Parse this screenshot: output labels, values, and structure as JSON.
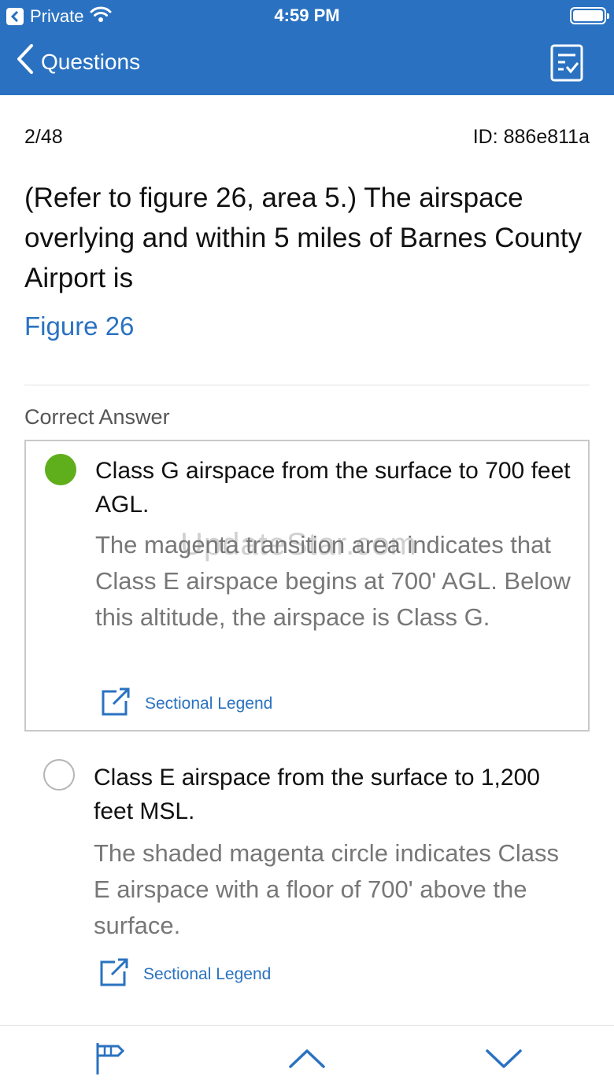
{
  "status_bar": {
    "carrier": "Private",
    "time": "4:59 PM"
  },
  "nav": {
    "back_label": "Questions"
  },
  "question": {
    "progress": "2/48",
    "id_label": "ID: 886e811a",
    "text": "(Refer to figure 26, area 5.) The airspace overlying and within 5 miles of Barnes County Airport is",
    "figure_link": "Figure 26"
  },
  "correct_answer_label": "Correct Answer",
  "answers": [
    {
      "text": "Class G airspace from the surface to 700 feet AGL.",
      "explanation": "The magenta transition area indicates that Class E airspace begins at 700' AGL.  Below this altitude, the airspace is Class G.",
      "link_label": "Sectional Legend",
      "selected": true
    },
    {
      "text": "Class E airspace from the surface to 1,200 feet MSL.",
      "explanation": "The shaded magenta circle indicates Class E airspace with a floor of 700' above the surface.",
      "link_label": "Sectional Legend",
      "selected": false
    }
  ],
  "watermark": "UpdateStar.com",
  "colors": {
    "header": "#2a72c1",
    "link": "#2a72c1",
    "correct": "#5fae1b"
  },
  "icons": {
    "nav_action": "checklist-icon",
    "toolbar": [
      "flag-icon",
      "chevron-up-icon",
      "chevron-down-icon"
    ]
  }
}
